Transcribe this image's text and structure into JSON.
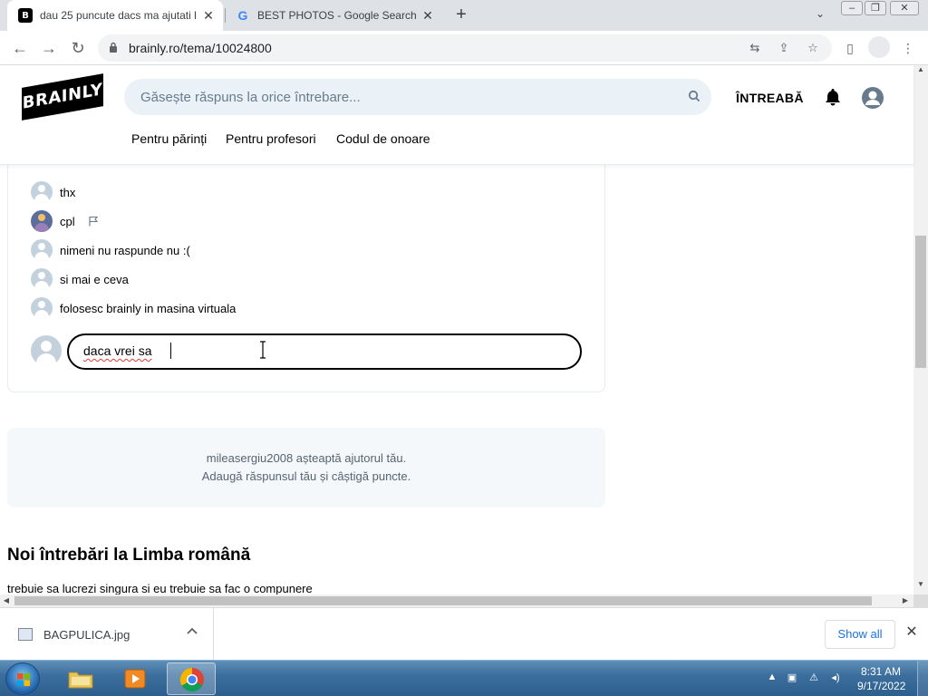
{
  "browser": {
    "tabs": [
      {
        "title": "dau 25 puncute dacs ma ajutati l",
        "favicon": "brainly-icon",
        "active": true
      },
      {
        "title": "BEST PHOTOS - Google Search",
        "favicon": "google-icon",
        "active": false
      }
    ],
    "new_tab_symbol": "+",
    "tab_close_symbol": "✕",
    "address": "brainly.ro/tema/10024800"
  },
  "site": {
    "logo_text": "BRAINLY",
    "search_placeholder": "Găsește răspuns la orice întrebare...",
    "ask_label": "ÎNTREABĂ",
    "subnav": [
      "Pentru părinți",
      "Pentru profesori",
      "Codul de onoare"
    ]
  },
  "comments": [
    {
      "text": "thx",
      "avatar": "default"
    },
    {
      "text": "cpl",
      "avatar": "photo",
      "flag": true
    },
    {
      "text": "nimeni nu raspunde nu :(",
      "avatar": "default"
    },
    {
      "text": "si mai e ceva",
      "avatar": "default"
    },
    {
      "text": "folosesc brainly in masina virtuala",
      "avatar": "default"
    }
  ],
  "reply": {
    "value": "daca vrei sa"
  },
  "help": {
    "line1": "mileasergiu2008 așteaptă ajutorul tău.",
    "line2": "Adaugă răspunsul tău și câștigă puncte."
  },
  "new_questions": {
    "title": "Noi întrebări la Limba română",
    "first": "trebuie sa lucrezi singura si eu trebuie sa fac o compunere"
  },
  "download": {
    "filename": "BAGPULICA.jpg",
    "show_all": "Show all"
  },
  "taskbar": {
    "time": "8:31 AM",
    "date": "9/17/2022"
  },
  "colors": {
    "brand": "#000000",
    "search_bg": "#ebf2f7",
    "help_bg": "#f5f8fa",
    "link": "#1a73e8"
  }
}
